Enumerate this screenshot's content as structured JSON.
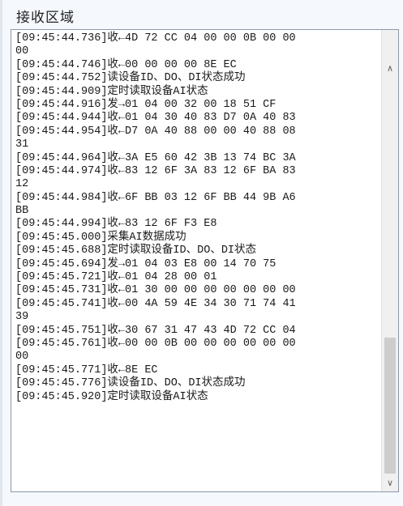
{
  "group_title": "接收区域",
  "log_lines": [
    "[09:45:44.736]收←4D 72 CC 04 00 00 0B 00 00",
    "00",
    "[09:45:44.746]收←00 00 00 00 8E EC",
    "[09:45:44.752]读设备ID、DO、DI状态成功",
    "[09:45:44.909]定时读取设备AI状态",
    "[09:45:44.916]发→01 04 00 32 00 18 51 CF",
    "[09:45:44.944]收←01 04 30 40 83 D7 0A 40 83",
    "[09:45:44.954]收←D7 0A 40 88 00 00 40 88 08",
    "31",
    "[09:45:44.964]收←3A E5 60 42 3B 13 74 BC 3A",
    "[09:45:44.974]收←83 12 6F 3A 83 12 6F BA 83",
    "12",
    "[09:45:44.984]收←6F BB 03 12 6F BB 44 9B A6",
    "BB",
    "[09:45:44.994]收←83 12 6F F3 E8",
    "[09:45:45.000]采集AI数据成功",
    "[09:45:45.688]定时读取设备ID、DO、DI状态",
    "[09:45:45.694]发→01 04 03 E8 00 14 70 75",
    "[09:45:45.721]收←01 04 28 00 01",
    "[09:45:45.731]收←01 30 00 00 00 00 00 00 00",
    "[09:45:45.741]收←00 4A 59 4E 34 30 71 74 41",
    "39",
    "[09:45:45.751]收←30 67 31 47 43 4D 72 CC 04",
    "[09:45:45.761]收←00 00 0B 00 00 00 00 00 00",
    "00",
    "[09:45:45.771]收←8E EC",
    "[09:45:45.776]读设备ID、DO、DI状态成功",
    "[09:45:45.920]定时读取设备AI状态"
  ],
  "scrollbar": {
    "up_icon": "chevron-up-icon",
    "down_icon": "chevron-down-icon"
  }
}
